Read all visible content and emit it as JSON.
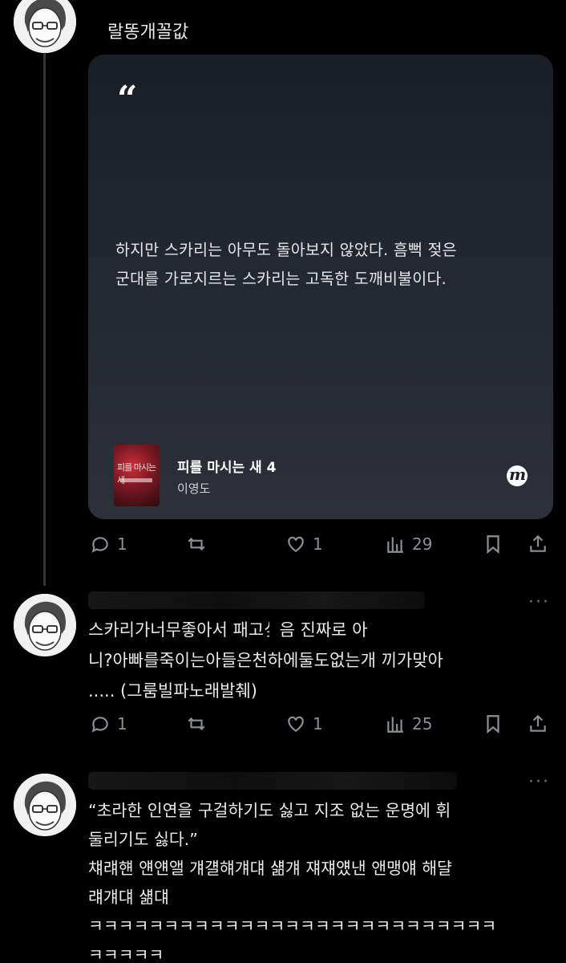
{
  "tweet1": {
    "name": "랄똥개꼴값",
    "quote_mark": "“",
    "quote_text": "하지만 스카리는 아무도 돌아보지 않았다. 흠뻑 젖은\n군대를 가로지르는 스카리는 고독한 도깨비불이다.",
    "book": {
      "cover_title": "피를 마시는 새",
      "title": "피를 마시는 새 4",
      "author": "이영도"
    },
    "brand_glyph": "m",
    "stats": {
      "replies": "1",
      "retweets": "",
      "likes": "1",
      "views": "29"
    }
  },
  "reply1": {
    "text": "스카리가너무좋아서  패고싶음 진짜로          아\n니?아빠를죽이는아들은천하에둘도없는개    끼가맞아\n.....  (그룸빌파노래발췌)",
    "stats": {
      "replies": "1",
      "retweets": "",
      "likes": "1",
      "views": "25"
    }
  },
  "reply2": {
    "text": "“초라한 인연을 구걸하기도 싫고 지조 없는 운명에 휘\n둘리기도 싫다.”\n챼럐햰 얜얜앨 걔걜햬걔댸 섊걔 쟤쟤얬낸 앤맹얘 해댤\n럐걔댸 섊댸\nㅋㅋㅋㅋㅋㅋㅋㅋㅋㅋㅋㅋㅋㅋㅋㅋㅋㅋㅋㅋㅋㅋㅋㅋㅋㅋㅋ\nㅋㅋㅋㅋㅋ"
  },
  "more_label": "···"
}
